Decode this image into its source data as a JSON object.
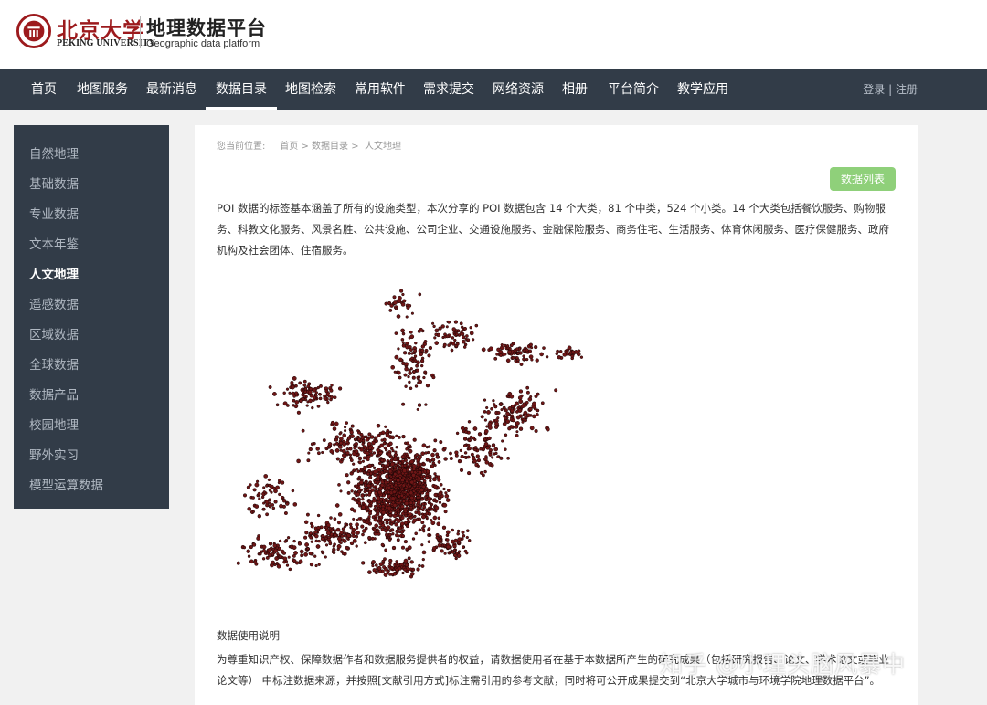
{
  "header": {
    "logo_cn": "北京大学",
    "logo_en": "PEKING UNIVERSITY",
    "platform_cn": "地理数据平台",
    "platform_en": "Geographic data platform",
    "brand_color": "#9c1a1d"
  },
  "nav": {
    "items": [
      "首页",
      "地图服务",
      "最新消息",
      "数据目录",
      "地图检索",
      "常用软件",
      "需求提交",
      "网络资源",
      "相册",
      "平台简介",
      "教学应用"
    ],
    "active": "数据目录",
    "login": "登录",
    "separator": "|",
    "register": "注册"
  },
  "sidebar": {
    "items": [
      "自然地理",
      "基础数据",
      "专业数据",
      "文本年鉴",
      "人文地理",
      "遥感数据",
      "区域数据",
      "全球数据",
      "数据产品",
      "校园地理",
      "野外实习",
      "模型运算数据"
    ],
    "active": "人文地理"
  },
  "breadcrumb": {
    "prefix": "您当前位置:",
    "home": "首页",
    "sep1": ">",
    "catalog": "数据目录",
    "sep2": ">",
    "current": "人文地理"
  },
  "main": {
    "list_button": "数据列表",
    "description": "POI 数据的标签基本涵盖了所有的设施类型，本次分享的 POI 数据包含 14 个大类，81 个中类，524 个小类。14 个大类包括餐饮服务、购物服务、科教文化服务、风景名胜、公共设施、公司企业、交通设施服务、金融保险服务、商务住宅、生活服务、体育休闲服务、医疗保健服务、政府机构及社会团体、住宿服务。",
    "map_point_color": "#6e1616",
    "notice_title": "数据使用说明",
    "notice_text": "为尊重知识产权、保障数据作者和数据服务提供者的权益，请数据使用者在基于本数据所产生的研究成果（包括研究报告、论文、学术论文或毕业论文等） 中标注数据来源，并按照[文献引用方式]标注需引用的参考文献，同时将可公开成果提交到“北京大学城市与环境学院地理数据平台”。"
  },
  "watermark": "知乎 @小理头脑风暴中"
}
